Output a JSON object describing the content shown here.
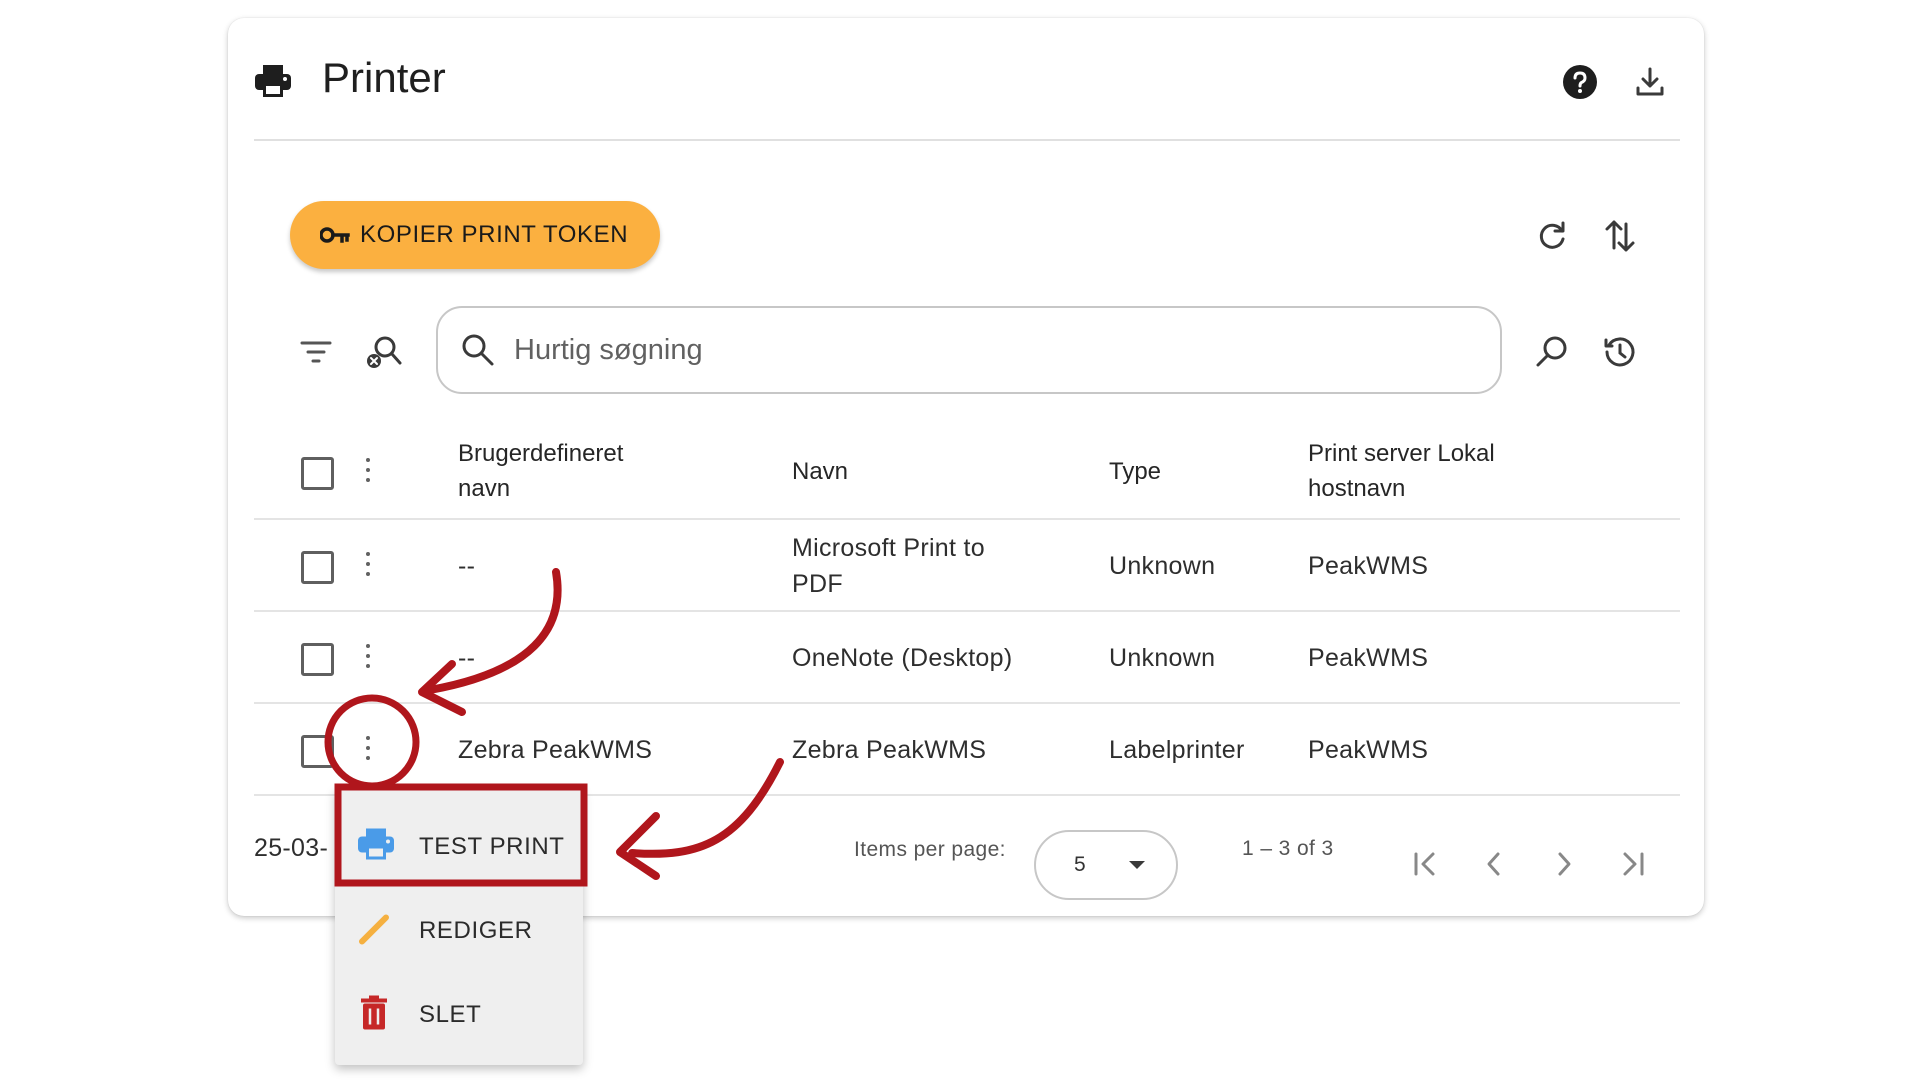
{
  "header": {
    "title": "Printer",
    "printer_icon": "printer-icon",
    "help_icon": "help-circle-icon",
    "download_icon": "download-icon"
  },
  "toolbar": {
    "token_button_label": "KOPIER PRINT TOKEN",
    "token_icon": "key-icon",
    "refresh_icon": "refresh-icon",
    "sort_icon": "swap-vertical-icon"
  },
  "search": {
    "placeholder": "Hurtig søgning",
    "value": ""
  },
  "table": {
    "columns": [
      {
        "line1": "Brugerdefineret",
        "line2": "navn"
      },
      {
        "line1": "Navn",
        "line2": ""
      },
      {
        "line1": "Type",
        "line2": ""
      },
      {
        "line1": "Print server Lokal",
        "line2": "hostnavn"
      }
    ],
    "rows": [
      {
        "custom_name": "--",
        "name_line1": "Microsoft Print to",
        "name_line2": "PDF",
        "type": "Unknown",
        "host": "PeakWMS"
      },
      {
        "custom_name": "--",
        "name_line1": "OneNote (Desktop)",
        "name_line2": "",
        "type": "Unknown",
        "host": "PeakWMS"
      },
      {
        "custom_name": "Zebra PeakWMS",
        "name_line1": "Zebra PeakWMS",
        "name_line2": "",
        "type": "Labelprinter",
        "host": "PeakWMS"
      }
    ]
  },
  "footer": {
    "date_partial": "25-03-",
    "items_per_page_label": "Items per page:",
    "items_per_page_value": "5",
    "range": "1 – 3 of 3"
  },
  "context_menu": {
    "items": [
      {
        "label": "TEST PRINT",
        "icon": "printer-icon"
      },
      {
        "label": "REDIGER",
        "icon": "pencil-icon"
      },
      {
        "label": "SLET",
        "icon": "trash-icon"
      }
    ]
  },
  "colors": {
    "accent": "#fbb040",
    "annotation": "#b0161c",
    "print_icon": "#4a9be8",
    "pencil_icon": "#f5b040",
    "trash_icon": "#c62828"
  }
}
